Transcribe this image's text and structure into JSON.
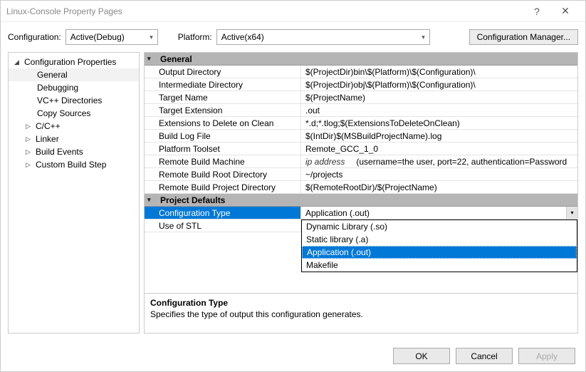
{
  "window": {
    "title": "Linux-Console Property Pages"
  },
  "toolbar": {
    "config_label": "Configuration:",
    "config_value": "Active(Debug)",
    "platform_label": "Platform:",
    "platform_value": "Active(x64)",
    "cfgmgr_label": "Configuration Manager..."
  },
  "tree": {
    "root": "Configuration Properties",
    "items": [
      {
        "label": "General",
        "selected": true
      },
      {
        "label": "Debugging"
      },
      {
        "label": "VC++ Directories"
      },
      {
        "label": "Copy Sources"
      },
      {
        "label": "C/C++",
        "expandable": true
      },
      {
        "label": "Linker",
        "expandable": true
      },
      {
        "label": "Build Events",
        "expandable": true
      },
      {
        "label": "Custom Build Step",
        "expandable": true
      }
    ]
  },
  "sections": {
    "general": {
      "title": "General",
      "rows": [
        {
          "name": "Output Directory",
          "value": "$(ProjectDir)bin\\$(Platform)\\$(Configuration)\\"
        },
        {
          "name": "Intermediate Directory",
          "value": "$(ProjectDir)obj\\$(Platform)\\$(Configuration)\\"
        },
        {
          "name": "Target Name",
          "value": "$(ProjectName)"
        },
        {
          "name": "Target Extension",
          "value": ".out"
        },
        {
          "name": "Extensions to Delete on Clean",
          "value": "*.d;*.tlog;$(ExtensionsToDeleteOnClean)"
        },
        {
          "name": "Build Log File",
          "value": "$(IntDir)$(MSBuildProjectName).log"
        },
        {
          "name": "Platform Toolset",
          "value": "Remote_GCC_1_0"
        },
        {
          "name": "Remote Build Machine",
          "italicPrefix": "ip address",
          "value": "(username=the user, port=22, authentication=Password"
        },
        {
          "name": "Remote Build Root Directory",
          "value": "~/projects"
        },
        {
          "name": "Remote Build Project Directory",
          "value": "$(RemoteRootDir)/$(ProjectName)"
        }
      ]
    },
    "defaults": {
      "title": "Project Defaults",
      "rows": [
        {
          "name": "Configuration Type",
          "value": "Application (.out)",
          "selected": true,
          "dropdown": true
        },
        {
          "name": "Use of STL",
          "value": ""
        }
      ]
    }
  },
  "dropdown": {
    "options": [
      {
        "label": "Dynamic Library (.so)"
      },
      {
        "label": "Static library (.a)"
      },
      {
        "label": "Application (.out)",
        "selected": true
      },
      {
        "label": "Makefile"
      }
    ]
  },
  "description": {
    "title": "Configuration Type",
    "text": "Specifies the type of output this configuration generates."
  },
  "buttons": {
    "ok": "OK",
    "cancel": "Cancel",
    "apply": "Apply"
  }
}
